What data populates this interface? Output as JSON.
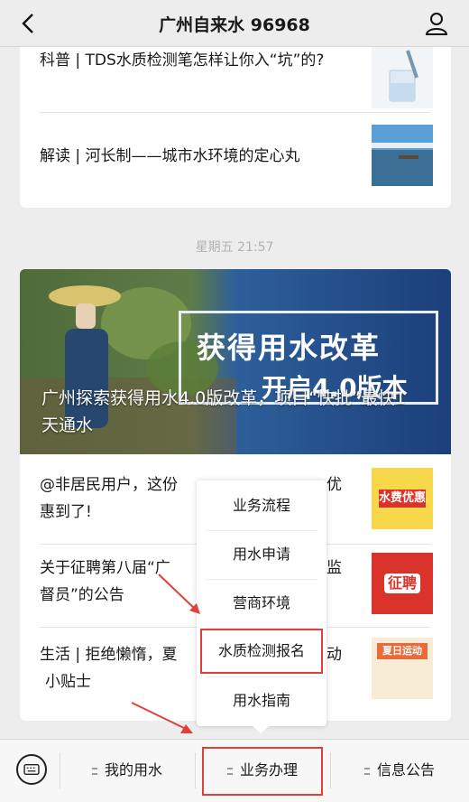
{
  "header": {
    "title": "广州自来水 96968"
  },
  "card1": {
    "items": [
      {
        "title": "科普 | TDS水质检测笔怎样让你入“坑”的?"
      },
      {
        "title": "解读 | 河长制——城市水环境的定心丸"
      }
    ]
  },
  "timestamp": "星期五 21:57",
  "card2": {
    "hero": {
      "title": "广州探索获得用水4.0版改革，项目“快批”最快1天通水",
      "overlay_line1": "获得用水改革",
      "overlay_line2": "开启4.0版本"
    },
    "items": [
      {
        "title_left": "@非居民用户，这份",
        "title_right": "优",
        "title2": "惠到了!",
        "thumb_text": "水费优惠"
      },
      {
        "title_left": "关于征聘第八届“广",
        "title_right": "监",
        "title2": "督员”的公告",
        "thumb_text": "征聘"
      },
      {
        "title_left": "生活 | 拒绝懒惰，夏",
        "title_right": "动",
        "title2": "小贴士",
        "thumb_text": "夏日运动"
      }
    ]
  },
  "popup_menu": {
    "items": [
      "业务流程",
      "用水申请",
      "营商环境",
      "水质检测报名",
      "用水指南"
    ],
    "highlighted_index": 3
  },
  "tabbar": {
    "tabs": [
      "我的用水",
      "业务办理",
      "信息公告"
    ],
    "active_index": 1
  },
  "colors": {
    "highlight": "#e0403b",
    "background": "#ededed"
  }
}
